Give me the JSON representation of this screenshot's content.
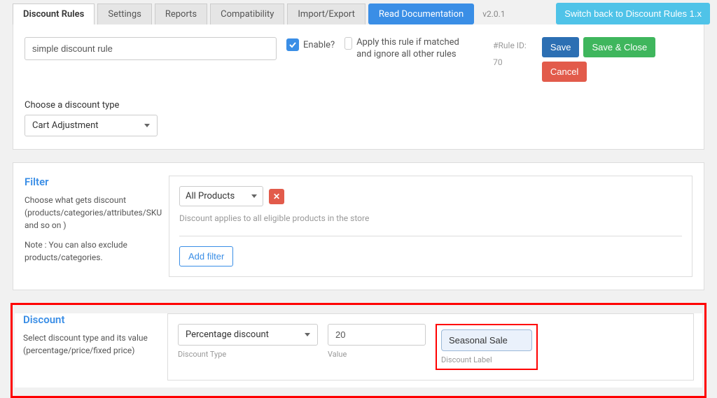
{
  "tabs": {
    "items": [
      "Discount Rules",
      "Settings",
      "Reports",
      "Compatibility",
      "Import/Export"
    ],
    "doc": "Read Documentation",
    "version": "v2.0.1",
    "switchback": "Switch back to Discount Rules 1.x"
  },
  "top": {
    "rule_name": "simple discount rule",
    "enable_label": "Enable?",
    "apply_label": "Apply this rule if matched and ignore all other rules",
    "rule_id_label": "#Rule ID:",
    "rule_id": "70",
    "save": "Save",
    "save_close": "Save & Close",
    "cancel": "Cancel",
    "type_label": "Choose a discount type",
    "type_value": "Cart Adjustment"
  },
  "filter": {
    "title": "Filter",
    "desc1": "Choose what gets discount (products/categories/attributes/SKU and so on )",
    "desc2": "Note : You can also exclude products/categories.",
    "select_value": "All Products",
    "hint": "Discount applies to all eligible products in the store",
    "add_filter": "Add filter"
  },
  "discount": {
    "title": "Discount",
    "desc": "Select discount type and its value (percentage/price/fixed price)",
    "type_value": "Percentage discount",
    "type_label": "Discount Type",
    "value": "20",
    "value_label": "Value",
    "label_value": "Seasonal Sale",
    "label_label": "Discount Label"
  }
}
